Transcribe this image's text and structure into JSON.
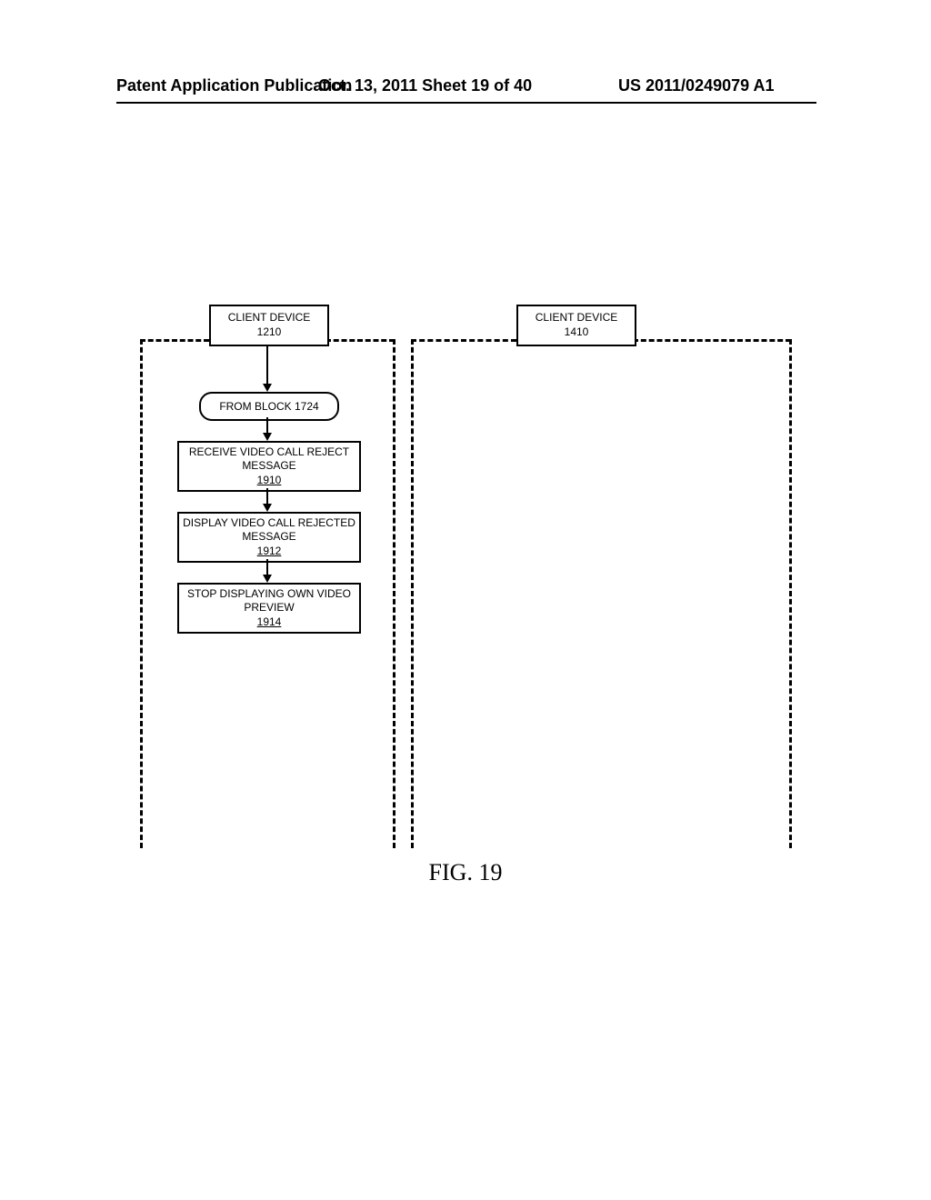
{
  "header": {
    "left": "Patent Application Publication",
    "center": "Oct. 13, 2011  Sheet 19 of 40",
    "right": "US 2011/0249079 A1"
  },
  "diagram": {
    "device_left": {
      "line1": "CLIENT DEVICE",
      "line2": "1210"
    },
    "device_right": {
      "line1": "CLIENT DEVICE",
      "line2": "1410"
    },
    "from_block": "FROM BLOCK 1724",
    "step_1910": {
      "line1": "RECEIVE VIDEO CALL REJECT",
      "line2": "MESSAGE",
      "ref": "1910"
    },
    "step_1912": {
      "line1": "DISPLAY VIDEO CALL REJECTED",
      "line2": "MESSAGE",
      "ref": "1912"
    },
    "step_1914": {
      "line1": "STOP DISPLAYING OWN VIDEO",
      "line2": "PREVIEW",
      "ref": "1914"
    }
  },
  "caption": "FIG. 19"
}
